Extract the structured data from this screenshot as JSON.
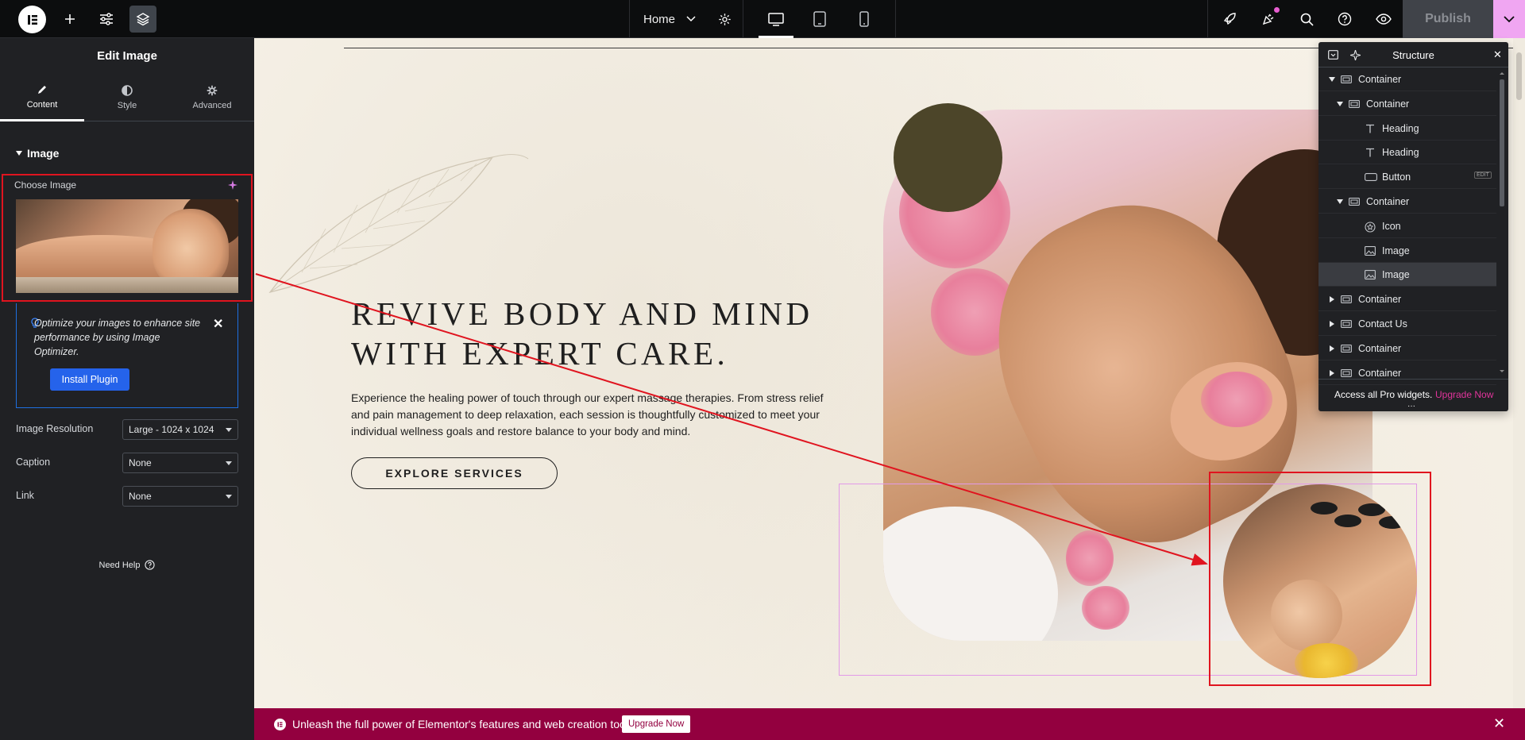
{
  "topbar": {
    "page_name": "Home",
    "publish_label": "Publish",
    "accent_color": "#f0a6f2",
    "icons": [
      "elementor-logo-icon",
      "add-element-icon",
      "site-settings-icon",
      "structure-icon",
      "page-settings-icon",
      "desktop-icon",
      "tablet-icon",
      "mobile-icon",
      "rocket-icon",
      "notifications-icon",
      "search-icon",
      "help-icon",
      "preview-icon",
      "chevron-down-icon"
    ]
  },
  "panel": {
    "title": "Edit Image",
    "tabs": [
      {
        "label": "Content",
        "icon": "pencil-icon",
        "active": true
      },
      {
        "label": "Style",
        "icon": "half-circle-icon",
        "active": false
      },
      {
        "label": "Advanced",
        "icon": "gear-icon",
        "active": false
      }
    ],
    "section": "Image",
    "choose_label": "Choose Image",
    "notice_text": "Optimize your images to enhance site performance by using Image Optimizer.",
    "install_label": "Install Plugin",
    "controls": [
      {
        "label": "Image Resolution",
        "value": "Large - 1024 x 1024"
      },
      {
        "label": "Caption",
        "value": "None"
      },
      {
        "label": "Link",
        "value": "None"
      }
    ],
    "need_help": "Need Help"
  },
  "canvas": {
    "headline_line1": "REVIVE BODY AND MIND",
    "headline_line2": "WITH EXPERT CARE.",
    "body": "Experience the healing power of touch through our expert massage therapies. From stress relief and pain management to deep relaxation, each session is thoughtfully customized to meet your individual wellness goals and restore balance to your body and mind.",
    "button": "EXPLORE SERVICES",
    "olive_color": "#4c4529"
  },
  "structure": {
    "title": "Structure",
    "items": [
      {
        "label": "Container",
        "type": "container",
        "expanded": true,
        "selected": false
      },
      {
        "label": "Container",
        "type": "container",
        "expanded": true,
        "selected": false
      },
      {
        "label": "Heading",
        "type": "heading",
        "selected": false
      },
      {
        "label": "Heading",
        "type": "heading",
        "selected": false
      },
      {
        "label": "Button",
        "type": "button",
        "selected": false
      },
      {
        "label": "Container",
        "type": "container",
        "expanded": true,
        "selected": false
      },
      {
        "label": "Icon",
        "type": "icon",
        "selected": false
      },
      {
        "label": "Image",
        "type": "image",
        "selected": false
      },
      {
        "label": "Image",
        "type": "image",
        "selected": true
      },
      {
        "label": "Container",
        "type": "container",
        "expanded": false,
        "selected": false
      },
      {
        "label": "Contact Us",
        "type": "container",
        "expanded": false,
        "selected": false
      },
      {
        "label": "Container",
        "type": "container",
        "expanded": false,
        "selected": false
      },
      {
        "label": "Container",
        "type": "container",
        "expanded": false,
        "selected": false
      }
    ],
    "edit_badge": "EDIT",
    "footer_text": "Access all Pro widgets.",
    "footer_link": "Upgrade Now",
    "footer_link_color": "#e0349b"
  },
  "promo": {
    "text": "Unleash the full power of Elementor's features and web creation tools.",
    "button": "Upgrade Now",
    "color": "#93003f"
  }
}
